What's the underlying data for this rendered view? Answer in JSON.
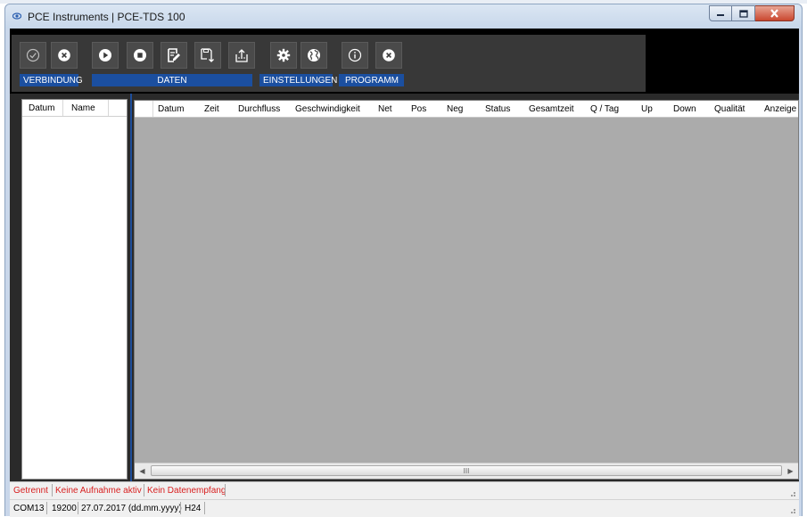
{
  "window": {
    "title": "PCE Instruments | PCE-TDS 100"
  },
  "toolbar": {
    "groups": [
      "VERBINDUNG",
      "DATEN",
      "EINSTELLUNGEN",
      "PROGRAMM"
    ],
    "buttons": [
      {
        "name": "connect-button",
        "icon": "check-circle-icon"
      },
      {
        "name": "disconnect-button",
        "icon": "x-circle-icon"
      },
      {
        "name": "start-recording-button",
        "icon": "play-icon"
      },
      {
        "name": "stop-recording-button",
        "icon": "stop-icon"
      },
      {
        "name": "edit-data-button",
        "icon": "edit-document-icon"
      },
      {
        "name": "save-data-button",
        "icon": "save-download-icon"
      },
      {
        "name": "export-data-button",
        "icon": "export-icon"
      },
      {
        "name": "settings-button",
        "icon": "gear-icon"
      },
      {
        "name": "language-button",
        "icon": "globe-icon"
      },
      {
        "name": "info-button",
        "icon": "info-icon"
      },
      {
        "name": "exit-button",
        "icon": "x-circle-icon"
      }
    ]
  },
  "left_list": {
    "columns": [
      "Datum",
      "Name"
    ]
  },
  "data_table": {
    "columns": [
      "Datum",
      "Zeit",
      "Durchfluss",
      "Geschwindigkeit",
      "Net",
      "Pos",
      "Neg",
      "Status",
      "Gesamtzeit",
      "Q / Tag",
      "Up",
      "Down",
      "Qualität",
      "Anzeige"
    ]
  },
  "scrollbar": {
    "thumb_label": "III"
  },
  "status_line1": [
    "Getrennt",
    "Keine Aufnahme aktiv",
    "Kein Datenempfang"
  ],
  "status_line2": [
    "COM13",
    "19200",
    "27.07.2017 (dd.mm.yyyy)",
    "H24"
  ],
  "colors": {
    "accent": "#1b4fa0",
    "toolbar_bg": "#383838",
    "status_red": "#d81e1e",
    "grid_bg": "#ababab"
  }
}
